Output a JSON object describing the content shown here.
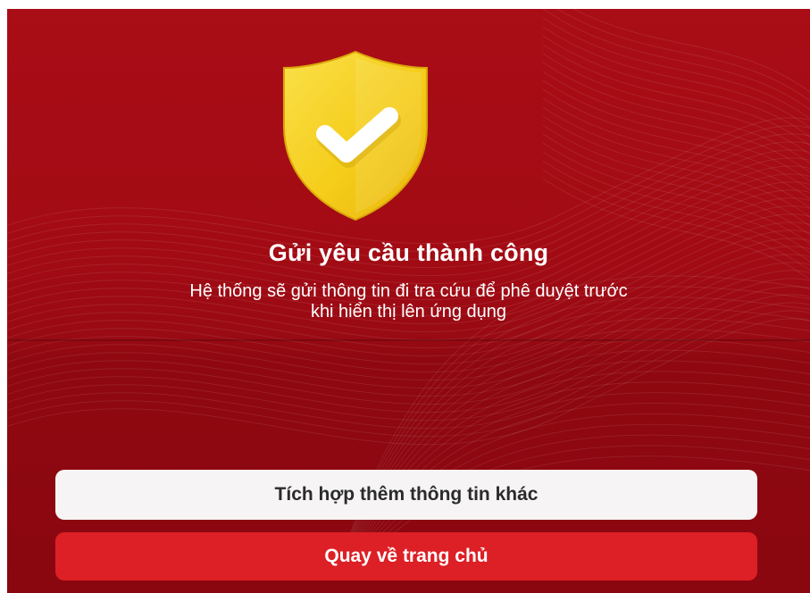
{
  "result": {
    "icon": "shield-check-icon",
    "title": "Gửi yêu cầu thành công",
    "message_line1": "Hệ thống sẽ gửi thông tin đi tra cứu để phê duyệt trước",
    "message_line2": "khi hiển thị lên ứng dụng"
  },
  "actions": {
    "secondary_label": "Tích hợp thêm thông tin khác",
    "primary_label": "Quay về trang chủ"
  },
  "colors": {
    "background": "#a30b14",
    "shield": "#f5d21c",
    "primary_button": "#dd2026",
    "secondary_button": "#f6f4f4"
  }
}
